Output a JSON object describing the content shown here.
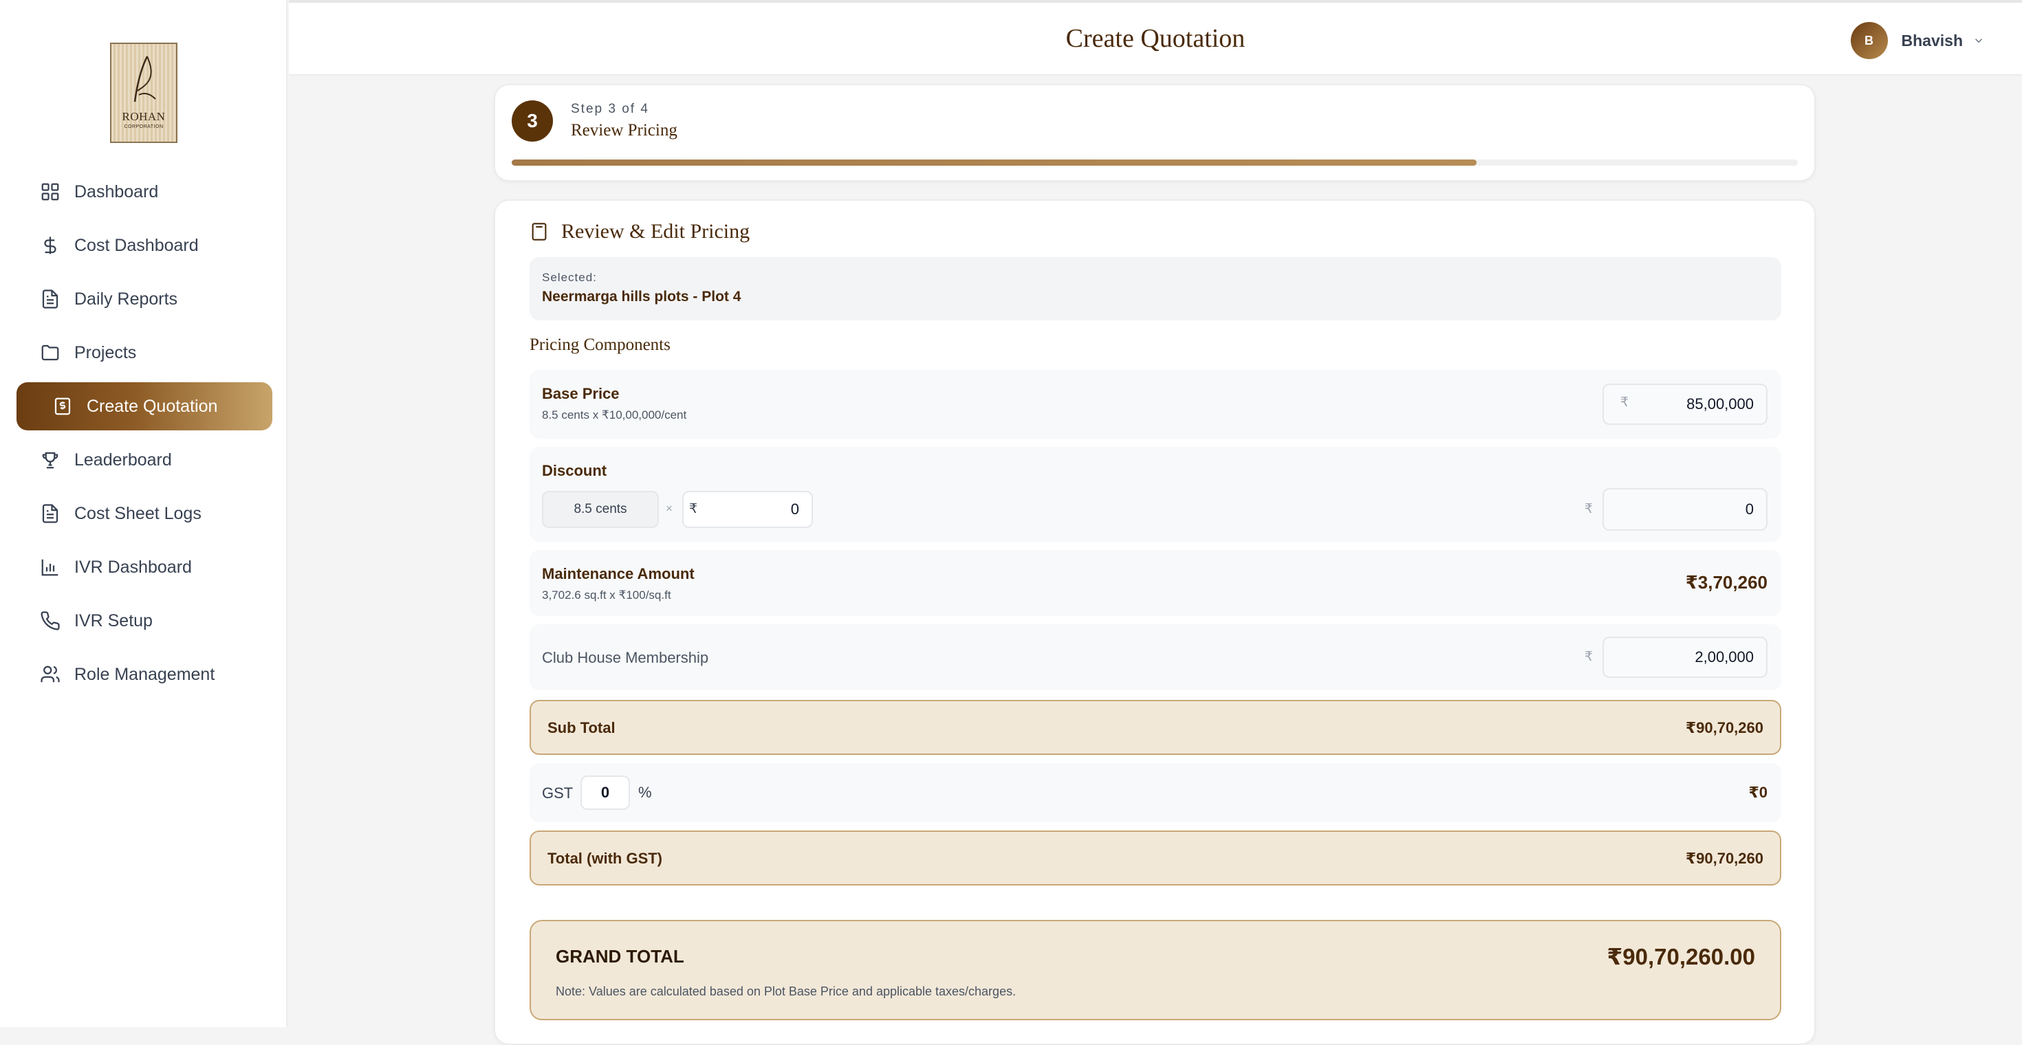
{
  "brand": {
    "logo_text": "ROHAN",
    "logo_sub": "CORPORATION"
  },
  "sidebar": {
    "items": [
      {
        "label": "Dashboard",
        "icon": "grid-icon"
      },
      {
        "label": "Cost Dashboard",
        "icon": "dollar-icon"
      },
      {
        "label": "Daily Reports",
        "icon": "document-icon"
      },
      {
        "label": "Projects",
        "icon": "folder-icon"
      },
      {
        "label": "Create Quotation",
        "icon": "receipt-icon",
        "active": true
      },
      {
        "label": "Leaderboard",
        "icon": "trophy-icon"
      },
      {
        "label": "Cost Sheet Logs",
        "icon": "document-icon"
      },
      {
        "label": "IVR Dashboard",
        "icon": "bar-chart-icon"
      },
      {
        "label": "IVR Setup",
        "icon": "phone-icon"
      },
      {
        "label": "Role Management",
        "icon": "users-icon"
      }
    ]
  },
  "header": {
    "title": "Create Quotation",
    "user": {
      "initial": "B",
      "name": "Bhavish"
    }
  },
  "step": {
    "number": "3",
    "of_label": "Step 3 of 4",
    "title": "Review Pricing",
    "progress": 0.75
  },
  "pricing": {
    "section_title": "Review & Edit Pricing",
    "selected_label": "Selected:",
    "selected_value": "Neermarga hills plots - Plot 4",
    "components_title": "Pricing Components",
    "base_price": {
      "label": "Base Price",
      "sub": "8.5 cents x ₹10,00,000/cent",
      "currency": "₹",
      "value": "85,00,000"
    },
    "discount": {
      "label": "Discount",
      "cents": "8.5 cents",
      "times": "×",
      "currency": "₹",
      "rate": "0",
      "value": "0"
    },
    "maintenance": {
      "label": "Maintenance Amount",
      "sub": "3,702.6 sq.ft x ₹100/sq.ft",
      "value": "₹3,70,260"
    },
    "club_house": {
      "label": "Club House Membership",
      "currency": "₹",
      "value": "2,00,000"
    },
    "sub_total": {
      "label": "Sub Total",
      "value": "₹90,70,260"
    },
    "gst": {
      "label": "GST",
      "rate": "0",
      "percent": "%",
      "value": "₹0"
    },
    "total_gst": {
      "label": "Total (with GST)",
      "value": "₹90,70,260"
    },
    "grand_total": {
      "label": "GRAND TOTAL",
      "value": "₹90,70,260.00",
      "note": "Note: Values are calculated based on Plot Base Price and applicable taxes/charges."
    }
  },
  "colors": {
    "accent": "#5b3309",
    "gold": "#c7a46a",
    "highlight_bg": "#f2e8d8"
  }
}
